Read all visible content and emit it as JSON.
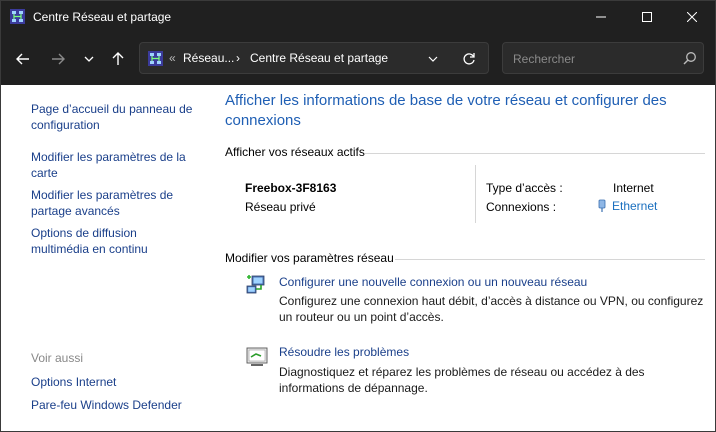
{
  "window": {
    "title": "Centre Réseau et partage"
  },
  "address": {
    "overflow": "«",
    "crumb1": "Réseau...",
    "sep": "›",
    "crumb2": "Centre Réseau et partage"
  },
  "search": {
    "placeholder": "Rechercher"
  },
  "left_pane": {
    "links": [
      "Page d’accueil du panneau de configuration",
      "Modifier les paramètres de la carte",
      "Modifier les paramètres de partage avancés",
      "Options de diffusion multimédia en continu"
    ],
    "see_also_title": "Voir aussi",
    "see_also": [
      "Options Internet",
      "Pare-feu Windows Defender"
    ]
  },
  "main": {
    "title": "Afficher les informations de base de votre réseau et configurer des connexions",
    "active_header": "Afficher vos réseaux actifs",
    "network": {
      "name": "Freebox-3F8163",
      "category": "Réseau privé",
      "access_label": "Type d’accès :",
      "access_value": "Internet",
      "connections_label": "Connexions :",
      "connections_value": "Ethernet"
    },
    "change_header": "Modifier vos paramètres réseau",
    "tasks": [
      {
        "link": "Configurer une nouvelle connexion ou un nouveau réseau",
        "desc": "Configurez une connexion haut débit, d’accès à distance ou VPN, ou configurez un routeur ou un point d’accès."
      },
      {
        "link": "Résoudre les problèmes",
        "desc": "Diagnostiquez et réparez les problèmes de réseau ou accédez à des informations de dépannage."
      }
    ]
  },
  "colors": {
    "link": "#1a3f8a",
    "title": "#1f5fb4",
    "chrome": "#202020"
  }
}
